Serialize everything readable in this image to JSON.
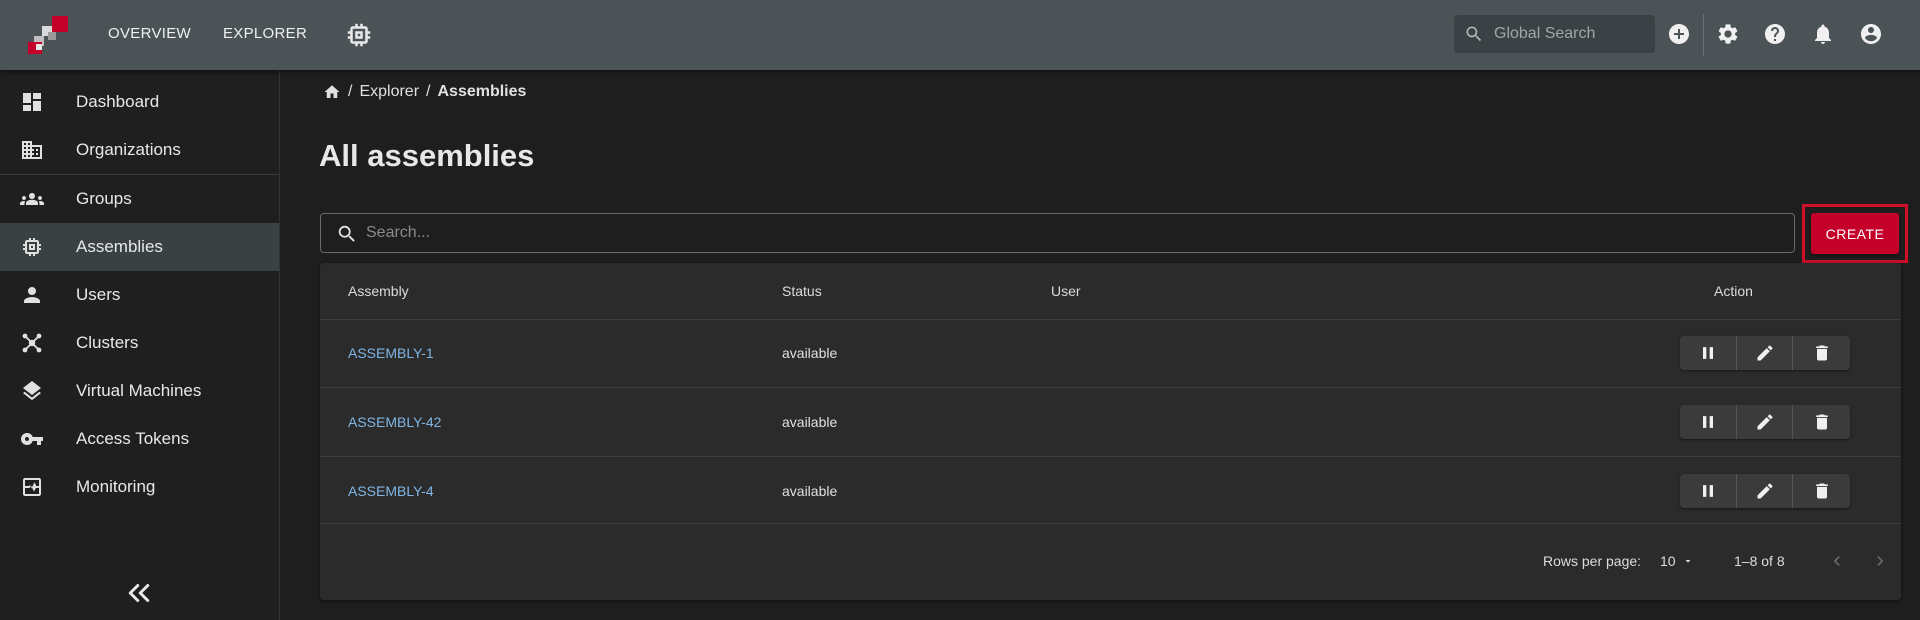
{
  "topbar": {
    "nav": [
      "OVERVIEW",
      "EXPLORER"
    ],
    "global_search_placeholder": "Global Search",
    "icons": [
      "chip-icon",
      "add-circle-icon",
      "gear-icon",
      "help-icon",
      "bell-icon",
      "account-icon"
    ],
    "brand_colors": {
      "red": "#c4002a",
      "light": "#d9d9d9",
      "gray": "#9a9a9a"
    }
  },
  "sidebar": {
    "items": [
      {
        "label": "Dashboard",
        "icon": "dashboard-icon"
      },
      {
        "label": "Organizations",
        "icon": "organization-icon"
      },
      {
        "label": "Groups",
        "icon": "groups-icon"
      },
      {
        "label": "Assemblies",
        "icon": "chip-icon",
        "active": true
      },
      {
        "label": "Users",
        "icon": "user-icon"
      },
      {
        "label": "Clusters",
        "icon": "cluster-icon"
      },
      {
        "label": "Virtual Machines",
        "icon": "layers-icon"
      },
      {
        "label": "Access Tokens",
        "icon": "key-icon"
      },
      {
        "label": "Monitoring",
        "icon": "monitoring-icon"
      }
    ],
    "collapse_icon": "double-chevron-left-icon"
  },
  "breadcrumb": {
    "home_icon": "home-icon",
    "items": [
      "Explorer",
      "Assemblies"
    ],
    "separator": "/"
  },
  "page": {
    "title": "All assemblies"
  },
  "search": {
    "placeholder": "Search..."
  },
  "create_label": "CREATE",
  "table": {
    "columns": [
      "Assembly",
      "Status",
      "User",
      "Action"
    ],
    "rows": [
      {
        "assembly": "ASSEMBLY-1",
        "status": "available",
        "user": ""
      },
      {
        "assembly": "ASSEMBLY-42",
        "status": "available",
        "user": ""
      },
      {
        "assembly": "ASSEMBLY-4",
        "status": "available",
        "user": ""
      }
    ],
    "action_icons": [
      "pause-icon",
      "edit-icon",
      "delete-icon"
    ]
  },
  "pagination": {
    "rows_per_page_label": "Rows per page:",
    "rows_per_page": "10",
    "range": "1–8 of 8"
  },
  "colors": {
    "accent": "#c4002a",
    "link": "#7fb6e6",
    "topbar": "#4b5356",
    "highlight": "#d0102a"
  }
}
